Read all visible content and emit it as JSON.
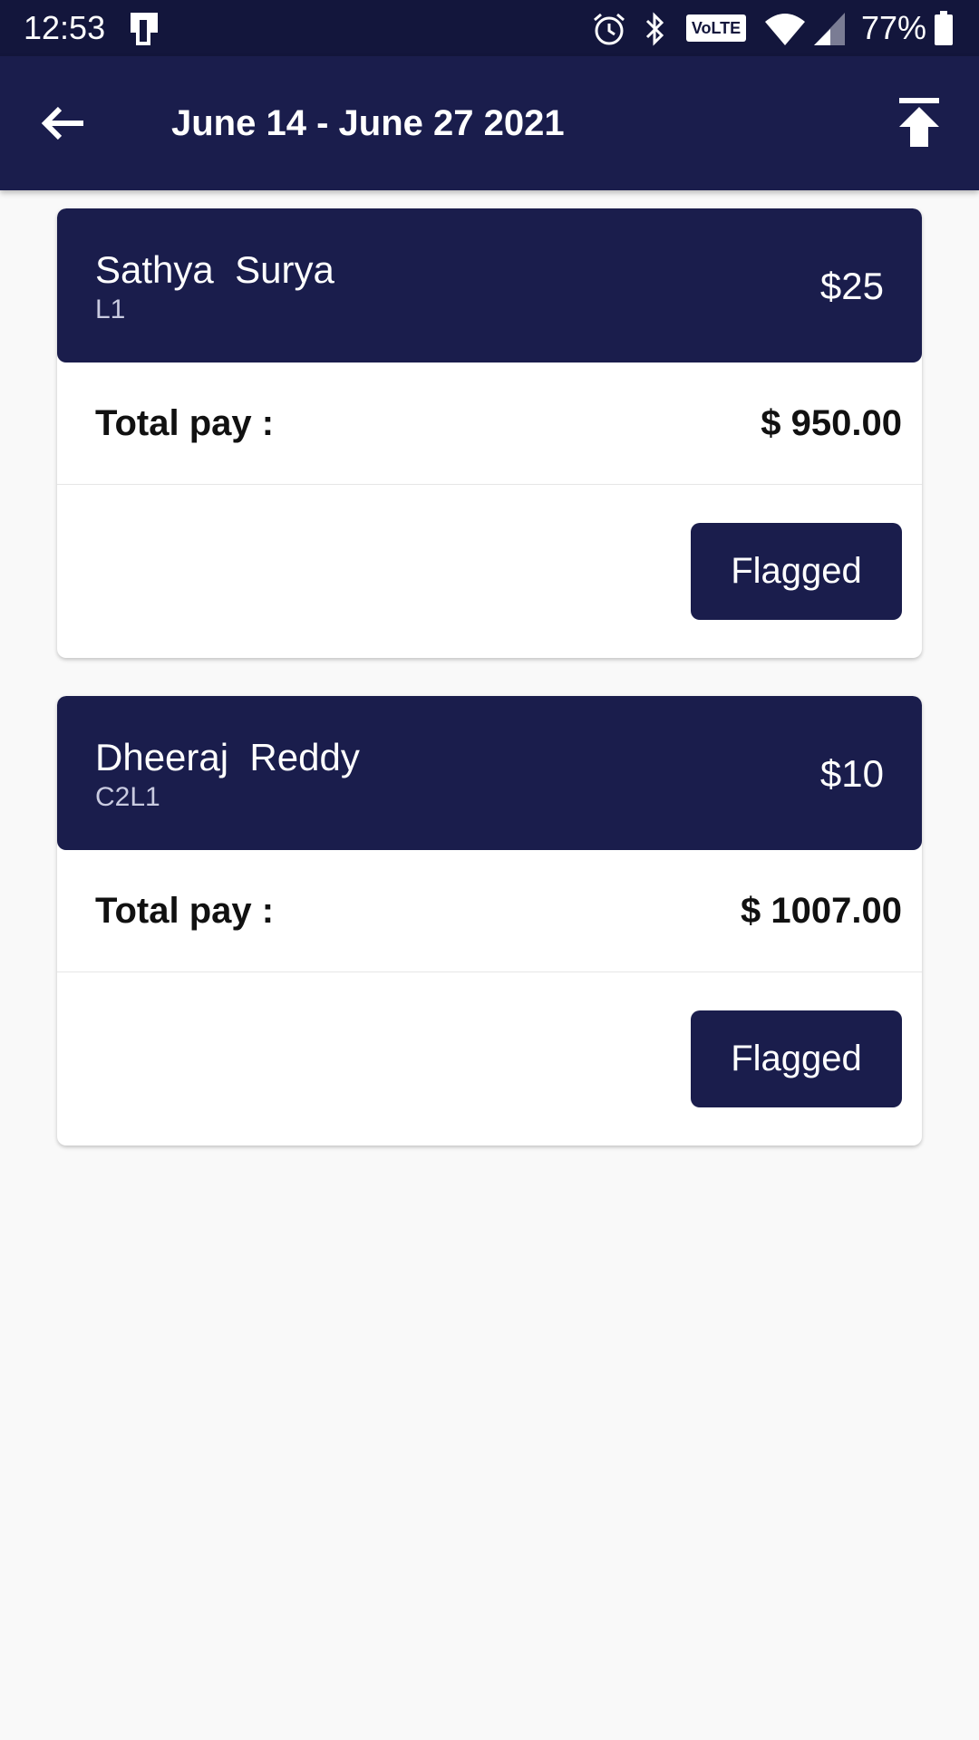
{
  "status_bar": {
    "time": "12:53",
    "battery": "77%",
    "volte": "VoLTE",
    "icons": [
      "screen-cast-icon",
      "alarm-icon",
      "bluetooth-icon",
      "volte-icon",
      "wifi-icon",
      "signal-icon",
      "battery-icon"
    ]
  },
  "app_bar": {
    "title": "June 14 - June 27 2021",
    "back_icon": "arrow-left-icon",
    "action_icon": "upload-icon"
  },
  "employees": [
    {
      "name": "Sathya  Surya",
      "code": "L1",
      "rate": "$25",
      "total_pay_label": "Total pay :",
      "total_pay_value": "$ 950.00",
      "status_button": "Flagged"
    },
    {
      "name": "Dheeraj  Reddy",
      "code": "C2L1",
      "rate": "$10",
      "total_pay_label": "Total pay :",
      "total_pay_value": "$ 1007.00",
      "status_button": "Flagged"
    }
  ],
  "colors": {
    "status_bar": "#13163c",
    "primary": "#1a1d4c",
    "background": "#f9f9f9"
  }
}
